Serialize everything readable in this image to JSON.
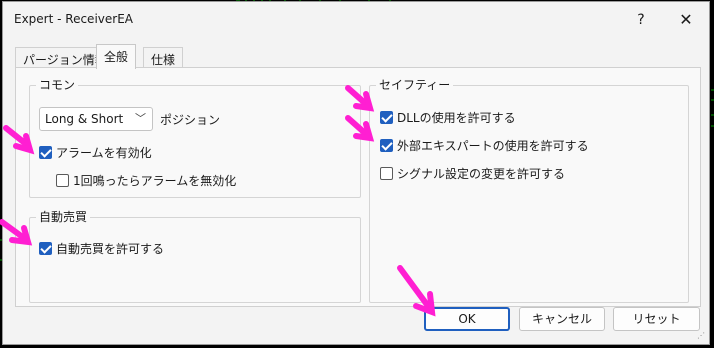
{
  "window": {
    "title": "Expert - ReceiverEA",
    "help_label": "?",
    "close_label": "✕"
  },
  "tabs": [
    {
      "label": "パージョン情報",
      "active": false
    },
    {
      "label": "全般",
      "active": true
    },
    {
      "label": "仕様",
      "active": false
    }
  ],
  "common_group": {
    "label": "コモン",
    "position_select": {
      "value": "Long & Short"
    },
    "position_label": "ポジション",
    "alert_checkbox": {
      "label": "アラームを有効化",
      "checked": true
    },
    "disable_alarm_checkbox": {
      "label": "1回鳴ったらアラームを無効化",
      "checked": false
    }
  },
  "auto_trading_group": {
    "label": "自動売買",
    "allow_auto_trading_checkbox": {
      "label": "自動売買を許可する",
      "checked": true
    }
  },
  "safety_group": {
    "label": "セイフティー",
    "allow_dll_checkbox": {
      "label": "DLLの使用を許可する",
      "checked": true
    },
    "allow_external_expert_checkbox": {
      "label": "外部エキスパートの使用を許可する",
      "checked": true
    },
    "allow_signal_change_checkbox": {
      "label": "シグナル設定の変更を許可する",
      "checked": false
    }
  },
  "buttons": {
    "ok_label": "OK",
    "cancel_label": "キャンセル",
    "reset_label": "リセット"
  },
  "colors": {
    "accent": "#1f5fbf",
    "annotation_arrow": "#ff1fd2",
    "background_chart": "#00a000"
  }
}
